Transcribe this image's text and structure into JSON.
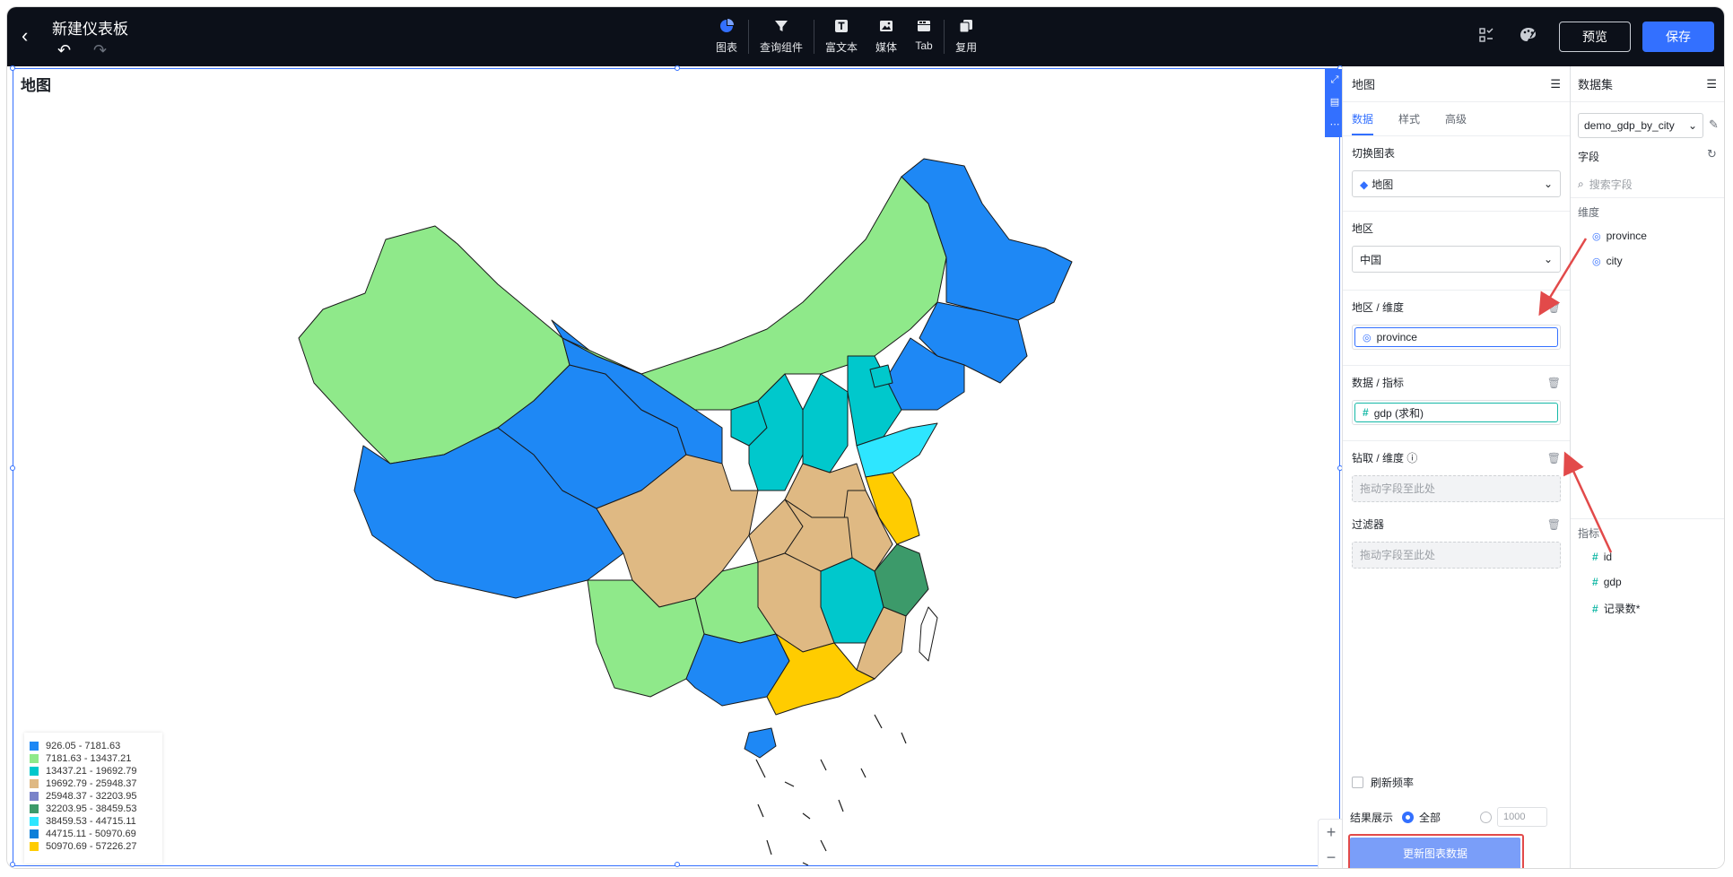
{
  "header": {
    "title": "新建仪表板",
    "tools": [
      {
        "label": "图表",
        "icon": "pie-chart-icon"
      },
      {
        "label": "查询组件",
        "icon": "filter-icon"
      },
      {
        "label": "富文本",
        "icon": "text-icon"
      },
      {
        "label": "媒体",
        "icon": "image-icon"
      },
      {
        "label": "Tab",
        "icon": "tab-icon"
      },
      {
        "label": "复用",
        "icon": "copy-icon"
      }
    ],
    "preview_label": "预览",
    "save_label": "保存"
  },
  "canvas": {
    "chart_title": "地图",
    "legend": [
      {
        "label": "926.05 - 7181.63",
        "color": "#1e88f5"
      },
      {
        "label": "7181.63 - 13437.21",
        "color": "#8fe98a"
      },
      {
        "label": "13437.21 - 19692.79",
        "color": "#00c8cc"
      },
      {
        "label": "19692.79 - 25948.37",
        "color": "#dfb983"
      },
      {
        "label": "25948.37 - 32203.95",
        "color": "#7a83c9"
      },
      {
        "label": "32203.95 - 38459.53",
        "color": "#3c9a6a"
      },
      {
        "label": "38459.53 - 44715.11",
        "color": "#2ee6ff"
      },
      {
        "label": "44715.11 - 50970.69",
        "color": "#0b7fd9"
      },
      {
        "label": "50970.69 - 57226.27",
        "color": "#ffcc00"
      }
    ]
  },
  "panel": {
    "title": "地图",
    "tabs": [
      "数据",
      "样式",
      "高级"
    ],
    "switch_chart_label": "切换图表",
    "switch_chart_value": "地图",
    "region_label": "地区",
    "region_value": "中国",
    "region_dim_label": "地区 / 维度",
    "region_dim_field": "province",
    "metric_label": "数据 / 指标",
    "metric_field": "gdp (求和)",
    "drill_label": "钻取 / 维度",
    "drill_placeholder": "拖动字段至此处",
    "filter_label": "过滤器",
    "filter_placeholder": "拖动字段至此处",
    "refresh_label": "刷新频率",
    "result_label": "结果展示",
    "result_all": "全部",
    "result_limit": "1000",
    "update_button": "更新图表数据"
  },
  "dataset": {
    "title": "数据集",
    "selected": "demo_gdp_by_city",
    "fields_label": "字段",
    "search_placeholder": "搜索字段",
    "dimensions_label": "维度",
    "dimensions": [
      "province",
      "city"
    ],
    "metrics_label": "指标",
    "metrics": [
      "id",
      "gdp",
      "记录数*"
    ]
  }
}
